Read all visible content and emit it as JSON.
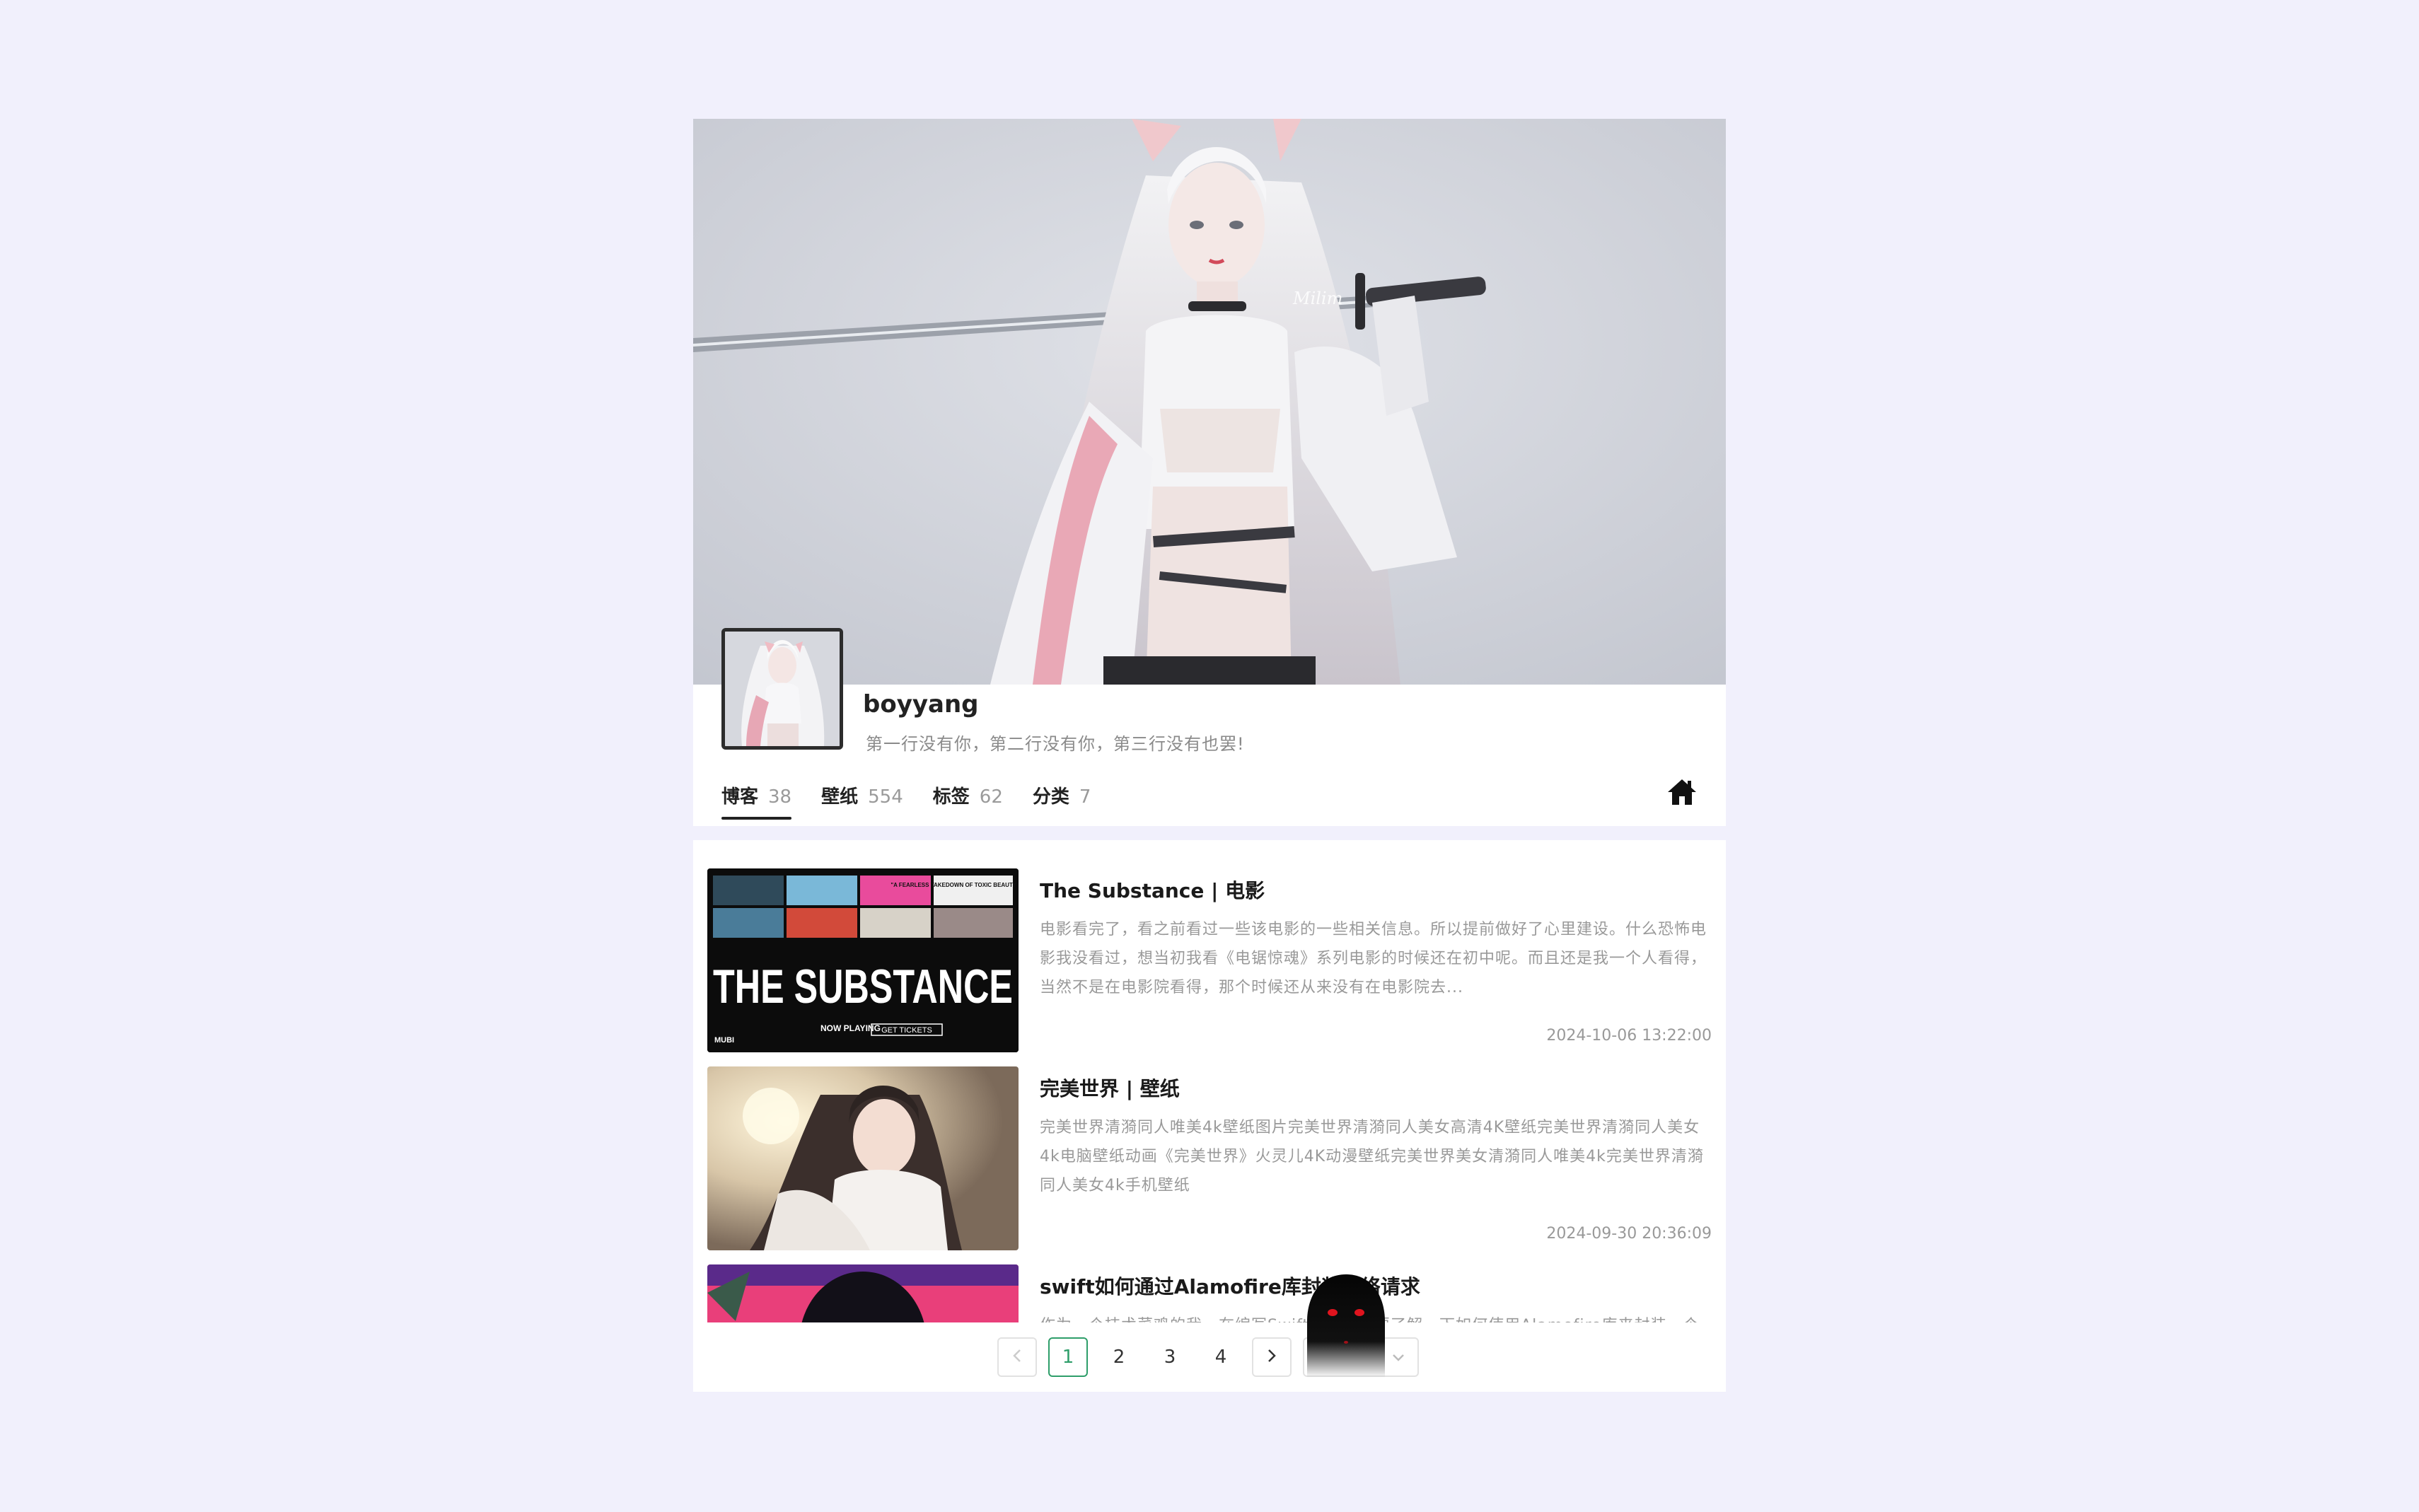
{
  "profile": {
    "username": "boyyang",
    "signature": "第一行没有你，第二行没有你，第三行没有也罢!",
    "stats": [
      {
        "label": "博客",
        "count": "38"
      },
      {
        "label": "壁纸",
        "count": "554"
      },
      {
        "label": "标签",
        "count": "62"
      },
      {
        "label": "分类",
        "count": "7"
      }
    ],
    "home_icon": "home-icon",
    "banner_watermark": "Milim"
  },
  "posts": [
    {
      "title": "The Substance | 电影",
      "description": "电影看完了，看之前看过一些该电影的一些相关信息。所以提前做好了心里建设。什么恐怖电影我没看过，想当初我看《电锯惊魂》系列电影的时候还在初中呢。而且还是我一个人看得，当然不是在电影院看得，那个时候还从来没有在电影院去...",
      "date": "2024-10-06 13:22:00",
      "thumb": {
        "headline": "THE SUBSTANCE",
        "quote": "\"A FEARLESS TAKEDOWN OF TOXIC BEAUTY STANDARDS\"",
        "now_playing": "NOW PLAYING",
        "tickets": "GET TICKETS",
        "brand": "MUBI"
      }
    },
    {
      "title": "完美世界 | 壁纸",
      "description": "完美世界清漪同人唯美4k壁纸图片完美世界清漪同人美女高清4K壁纸完美世界清漪同人美女4k电脑壁纸动画《完美世界》火灵儿4K动漫壁纸完美世界美女清漪同人唯美4k完美世界清漪同人美女4k手机壁纸",
      "date": "2024-09-30 20:36:09"
    },
    {
      "title": "swift如何通过Alamofire库封装网络请求",
      "description": "作为一个技术菜鸡的我，在编写Swift代码时需要了解一下如何使用Alamofire库来封装一个网络请求，总是想先了解一下整个流程。",
      "date": ""
    }
  ],
  "pagination": {
    "prev_icon": "chevron-left-icon",
    "next_icon": "chevron-right-icon",
    "pages": [
      "1",
      "2",
      "3",
      "4"
    ],
    "current": "1",
    "page_size_icon": "chevron-down-icon"
  },
  "colors": {
    "background": "#f1f0fc",
    "active_page": "#2e9e6a"
  }
}
